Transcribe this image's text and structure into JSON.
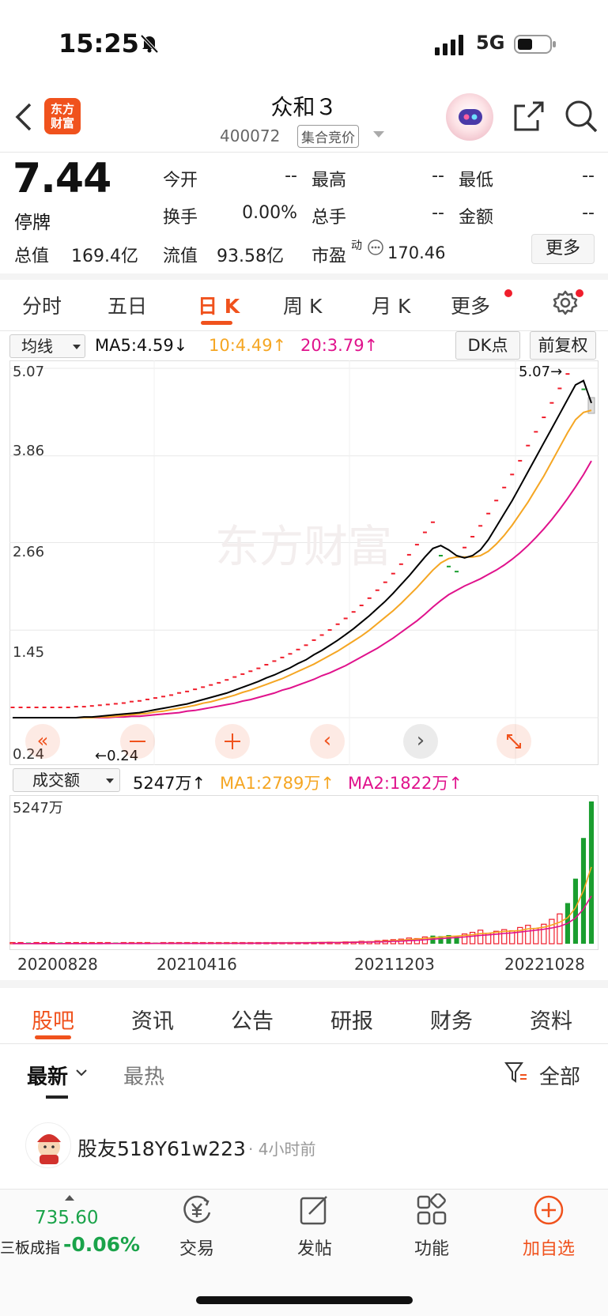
{
  "status_bar": {
    "time": "15:25",
    "network": "5G"
  },
  "header": {
    "logo_line1": "东方",
    "logo_line2": "财富",
    "stock_name": "众和３",
    "stock_code": "400072",
    "auction_label": "集合竞价"
  },
  "quote": {
    "price": "7.44",
    "status": "停牌",
    "today_open_label": "今开",
    "today_open": "--",
    "high_label": "最高",
    "high": "--",
    "low_label": "最低",
    "low": "--",
    "turnover_label": "换手",
    "turnover": "0.00%",
    "total_hands_label": "总手",
    "total_hands": "--",
    "amount_label": "金额",
    "amount": "--",
    "total_value_label": "总值",
    "total_value": "169.4亿",
    "float_value_label": "流值",
    "float_value": "93.58亿",
    "pe_label": "市盈",
    "pe_sup": "动",
    "pe": "170.46",
    "more_label": "更多"
  },
  "chart_tabs": [
    "分时",
    "五日",
    "日 K",
    "周 K",
    "月 K",
    "更多"
  ],
  "indicator_bar": {
    "ma_select": "均线",
    "ma5": "MA5:4.59↓",
    "ma10": "10:4.49↑",
    "ma20": "20:3.79↑",
    "dk_label": "DK点",
    "adjust_label": "前复权"
  },
  "volume_bar": {
    "select": "成交额",
    "value": "5247万↑",
    "ma1": "MA1:2789万↑",
    "ma2": "MA2:1822万↑"
  },
  "chart_labels": {
    "max_marker": "5.07→",
    "min_marker": "←0.24",
    "vol_max": "5247万"
  },
  "colors": {
    "accent": "#f0521d",
    "up": "#f01e2c",
    "down": "#1a9e2f",
    "ma5": "#000000",
    "ma10": "#f5a623",
    "ma20": "#e0128c",
    "index_green": "#1aa34a"
  },
  "chart_data": {
    "type": "candlestick",
    "price_axis": {
      "ylim": [
        0.24,
        5.07
      ],
      "ticks": [
        "5.07",
        "3.86",
        "2.66",
        "1.45",
        "0.24"
      ]
    },
    "x_dates": [
      "20200828",
      "20210416",
      "20211203",
      "20221028"
    ],
    "close": [
      0.24,
      0.24,
      0.24,
      0.24,
      0.24,
      0.24,
      0.24,
      0.24,
      0.25,
      0.25,
      0.26,
      0.27,
      0.28,
      0.29,
      0.3,
      0.32,
      0.33,
      0.35,
      0.37,
      0.39,
      0.41,
      0.44,
      0.46,
      0.49,
      0.52,
      0.55,
      0.58,
      0.62,
      0.66,
      0.7,
      0.74,
      0.78,
      0.83,
      0.88,
      0.93,
      0.98,
      1.04,
      1.1,
      1.17,
      1.24,
      1.31,
      1.39,
      1.47,
      1.56,
      1.65,
      1.75,
      1.86,
      1.97,
      2.09,
      2.22,
      2.35,
      2.49,
      2.66,
      2.8,
      2.6,
      2.45,
      2.38,
      2.45,
      2.6,
      2.75,
      2.92,
      3.1,
      3.28,
      3.46,
      3.65,
      3.86,
      4.05,
      4.25,
      4.45,
      4.65,
      4.85,
      5.07,
      4.9,
      4.6
    ],
    "ma5": [
      0.24,
      0.24,
      0.24,
      0.24,
      0.24,
      0.24,
      0.24,
      0.24,
      0.24,
      0.25,
      0.25,
      0.26,
      0.27,
      0.28,
      0.29,
      0.3,
      0.31,
      0.33,
      0.35,
      0.37,
      0.39,
      0.41,
      0.43,
      0.46,
      0.49,
      0.52,
      0.55,
      0.58,
      0.62,
      0.66,
      0.7,
      0.74,
      0.79,
      0.83,
      0.88,
      0.93,
      0.99,
      1.04,
      1.11,
      1.17,
      1.24,
      1.31,
      1.39,
      1.47,
      1.56,
      1.65,
      1.75,
      1.85,
      1.96,
      2.08,
      2.2,
      2.33,
      2.46,
      2.58,
      2.62,
      2.56,
      2.48,
      2.45,
      2.48,
      2.56,
      2.7,
      2.88,
      3.06,
      3.24,
      3.44,
      3.64,
      3.84,
      4.04,
      4.24,
      4.44,
      4.64,
      4.84,
      4.9,
      4.59
    ],
    "ma10": [
      0.24,
      0.24,
      0.24,
      0.24,
      0.24,
      0.24,
      0.24,
      0.24,
      0.24,
      0.24,
      0.24,
      0.25,
      0.25,
      0.26,
      0.27,
      0.28,
      0.29,
      0.3,
      0.32,
      0.33,
      0.35,
      0.37,
      0.39,
      0.41,
      0.44,
      0.46,
      0.49,
      0.52,
      0.55,
      0.59,
      0.62,
      0.66,
      0.7,
      0.74,
      0.78,
      0.83,
      0.88,
      0.93,
      0.98,
      1.04,
      1.1,
      1.16,
      1.23,
      1.3,
      1.37,
      1.45,
      1.54,
      1.63,
      1.72,
      1.82,
      1.93,
      2.04,
      2.16,
      2.28,
      2.38,
      2.44,
      2.46,
      2.46,
      2.46,
      2.48,
      2.54,
      2.64,
      2.76,
      2.9,
      3.06,
      3.22,
      3.4,
      3.58,
      3.78,
      3.98,
      4.18,
      4.36,
      4.46,
      4.49
    ],
    "ma20": [
      0.24,
      0.24,
      0.24,
      0.24,
      0.24,
      0.24,
      0.24,
      0.24,
      0.24,
      0.24,
      0.24,
      0.24,
      0.24,
      0.25,
      0.25,
      0.26,
      0.26,
      0.27,
      0.28,
      0.29,
      0.3,
      0.31,
      0.33,
      0.34,
      0.36,
      0.38,
      0.4,
      0.42,
      0.44,
      0.47,
      0.49,
      0.52,
      0.55,
      0.58,
      0.62,
      0.65,
      0.69,
      0.73,
      0.77,
      0.82,
      0.86,
      0.91,
      0.96,
      1.02,
      1.08,
      1.14,
      1.2,
      1.27,
      1.34,
      1.42,
      1.5,
      1.58,
      1.67,
      1.77,
      1.86,
      1.94,
      2.0,
      2.06,
      2.11,
      2.16,
      2.22,
      2.28,
      2.35,
      2.43,
      2.52,
      2.62,
      2.73,
      2.85,
      2.98,
      3.12,
      3.27,
      3.43,
      3.6,
      3.79
    ],
    "volume": [
      6,
      5,
      4,
      6,
      5,
      7,
      6,
      8,
      7,
      9,
      8,
      10,
      12,
      9,
      11,
      10,
      14,
      12,
      10,
      11,
      13,
      12,
      15,
      18,
      14,
      16,
      22,
      18,
      20,
      24,
      28,
      26,
      35,
      30,
      40,
      45,
      42,
      38,
      48,
      55,
      60,
      50,
      70,
      65,
      90,
      80,
      110,
      130,
      150,
      170,
      210,
      190,
      250,
      300,
      280,
      320,
      260,
      360,
      420,
      500,
      380,
      460,
      520,
      480,
      600,
      680,
      560,
      720,
      900,
      1100,
      1500,
      2400,
      3900,
      5247
    ],
    "volume_up": [
      true,
      true,
      false,
      true,
      true,
      true,
      false,
      true,
      true,
      true,
      true,
      true,
      true,
      false,
      true,
      true,
      true,
      true,
      false,
      true,
      true,
      true,
      true,
      true,
      true,
      true,
      true,
      true,
      true,
      true,
      true,
      true,
      true,
      true,
      true,
      true,
      true,
      true,
      true,
      true,
      true,
      true,
      true,
      true,
      true,
      true,
      true,
      true,
      true,
      true,
      true,
      true,
      true,
      false,
      false,
      false,
      false,
      true,
      true,
      true,
      true,
      true,
      true,
      true,
      true,
      true,
      true,
      true,
      true,
      true,
      false,
      false,
      false,
      false
    ],
    "vol_axis": {
      "ylim": [
        0,
        5247
      ],
      "label": "5247万"
    }
  },
  "bottom_tabs": [
    "股吧",
    "资讯",
    "公告",
    "研报",
    "财务",
    "资料"
  ],
  "sub_tabs": {
    "latest": "最新",
    "hot": "最热",
    "filter": "全部"
  },
  "post": {
    "user": "股友518Y61w223",
    "time": "· 4小时前"
  },
  "bottom_bar": {
    "index_value": "735.60",
    "index_name": "三板成指",
    "index_change": "-0.06%",
    "items": [
      "交易",
      "发帖",
      "功能",
      "加自选"
    ]
  }
}
